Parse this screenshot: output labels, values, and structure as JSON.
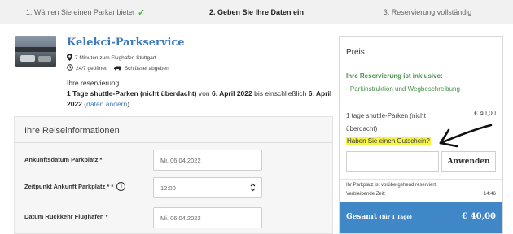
{
  "steps": [
    {
      "label": "1. Wählen Sie einen Parkanbieter",
      "done": true
    },
    {
      "label": "2. Geben Sie Ihre Daten ein"
    },
    {
      "label": "3. Reservierung vollständig"
    }
  ],
  "provider": {
    "name": "Kelekci-Parkservice",
    "distance": "7 Minuten zum Flughafen Stuttgart",
    "hours": "24/7 geöffnet",
    "keys": "Schlüssel abgeben",
    "reservation_label": "Ihre reservierung",
    "res_count": "1 Tage",
    "res_type": "shuttle-Parken (nicht überdacht)",
    "res_from_word": "von",
    "res_start": "6. April 2022",
    "res_until_word": "bis einschließlich",
    "res_end": "6. April 2022",
    "res_change_open": "(",
    "res_change_link": "daten ändern",
    "res_change_close": ")"
  },
  "travel": {
    "title": "Ihre Reiseinformationen",
    "fields": [
      {
        "label": "Ankunftsdatum Parkplatz *",
        "value": "Mi. 06.04.2022"
      },
      {
        "label": "Zeitpunkt Ankunft Parkplatz * *",
        "value": "12:00"
      },
      {
        "label": "Datum Rückkehr Flughafen *",
        "value": "Mi. 06.04.2022"
      }
    ]
  },
  "price": {
    "title": "Preis",
    "included_title": "Ihre Reservierung ist inklusive:",
    "included_item": "- Parkinstruktion und Wegbeschreibung",
    "line_desc": "1 tage shuttle-Parken (nicht überdacht)",
    "line_amount": "€ 40,00",
    "voucher_link": "Haben Sie einen Gutschein?",
    "voucher_input": "",
    "apply_button": "Anwenden",
    "reserved_note": "Ihr Parkplatz ist vorübergehend reserviert.",
    "remaining_label": "Verbleibende Zeit:",
    "remaining_time": "14:46",
    "total_label": "Gesamt",
    "total_sub": "(für 1 Tage)",
    "total_amount": "€ 40,00"
  },
  "colors": {
    "link_blue": "#3f7ab8",
    "total_bar": "#3f87c7",
    "included_green": "#4a8f4a",
    "check_green": "#4bb543",
    "highlight_yellow": "#f5f34a"
  },
  "icons": [
    "check-icon",
    "location-pin-icon",
    "clock-icon",
    "car-key-icon",
    "info-icon",
    "spinner-arrows-icon",
    "hand-drawn-arrow-icon"
  ]
}
